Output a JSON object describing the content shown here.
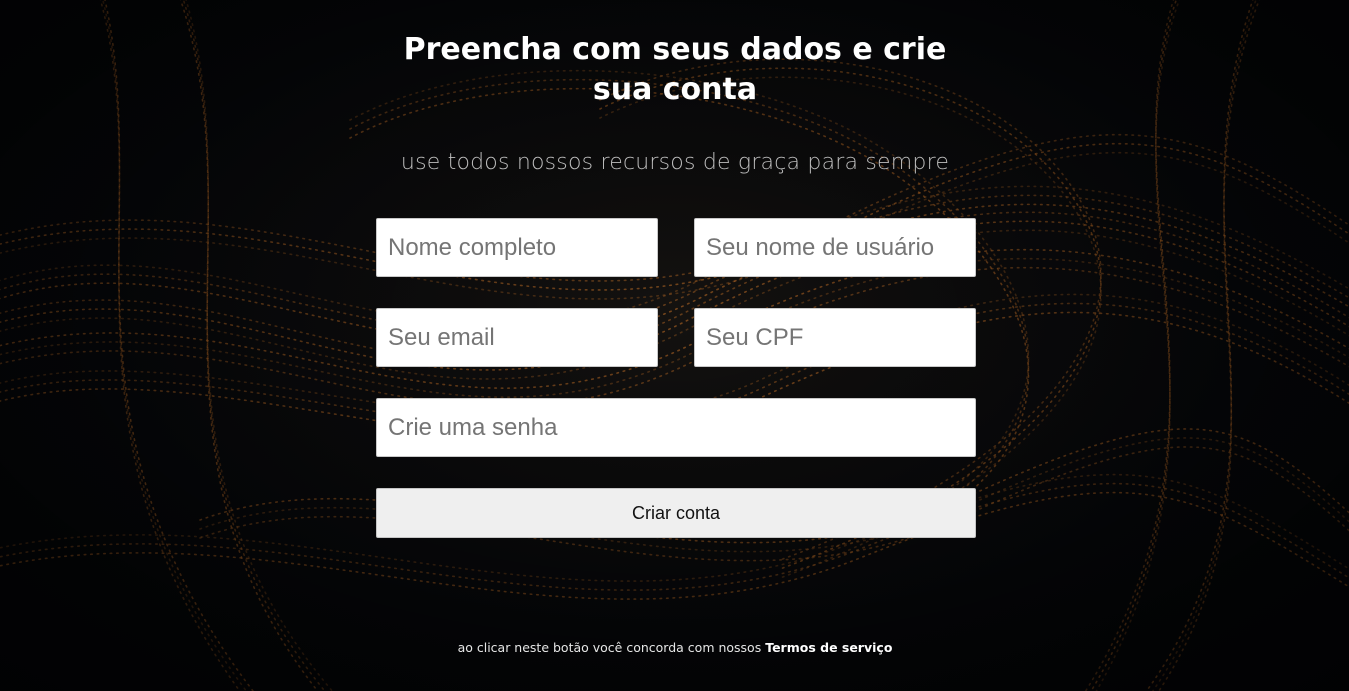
{
  "header": {
    "title_line1": "Preencha com seus dados e crie",
    "title_line2": "sua conta",
    "subtitle": "use todos nossos recursos de graça para sempre"
  },
  "form": {
    "full_name_placeholder": "Nome completo",
    "username_placeholder": "Seu nome de usuário",
    "email_placeholder": "Seu email",
    "cpf_placeholder": "Seu CPF",
    "password_placeholder": "Crie uma senha",
    "submit_label": "Criar conta"
  },
  "footer": {
    "terms_text": "ao clicar neste botão você concorda com nossos",
    "terms_link": "Termos de serviço"
  },
  "colors": {
    "background": "#040508",
    "background_lights": "#b86a26",
    "title_text": "#ffffff",
    "subtitle_text": "#bdbdbd",
    "button_bg": "#efefef"
  }
}
